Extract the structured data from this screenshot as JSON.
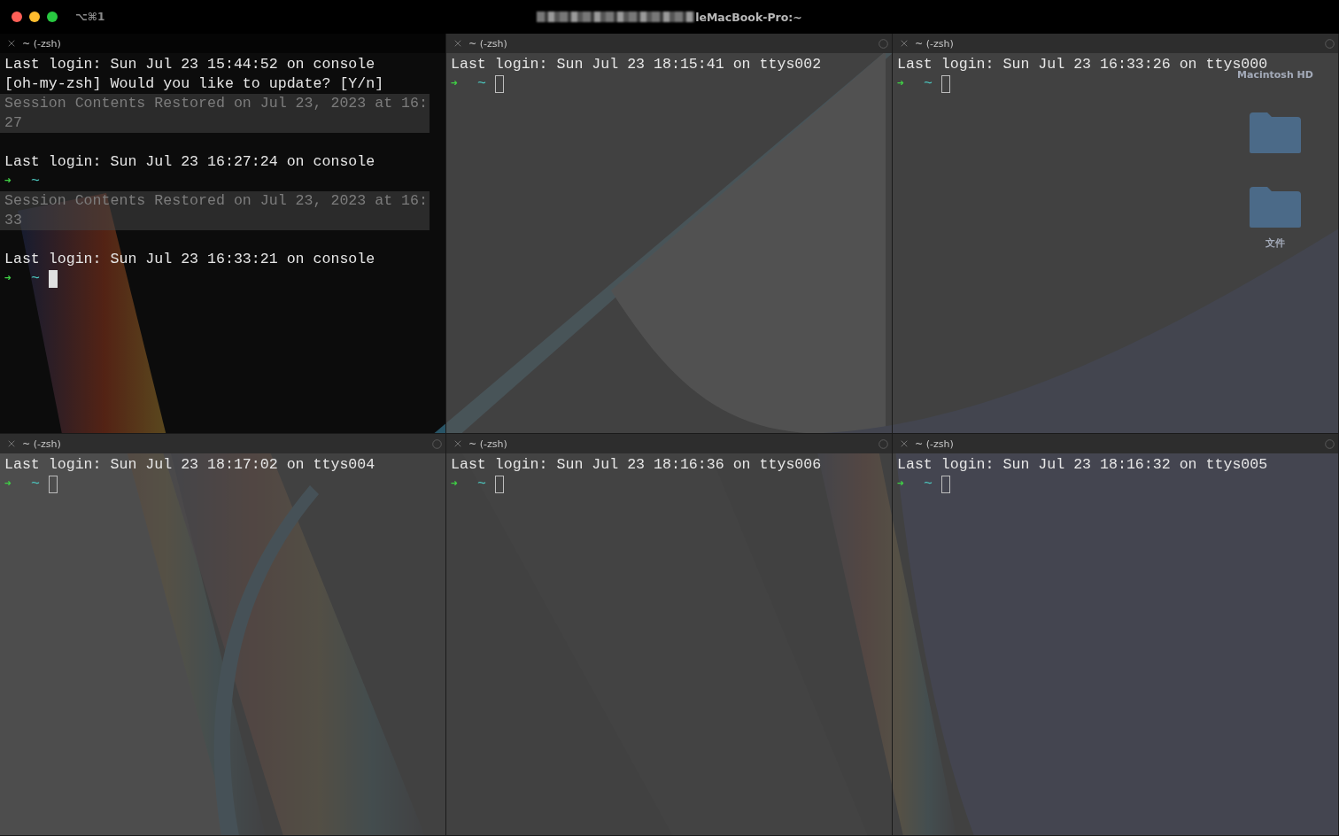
{
  "window": {
    "shortcut": "⌥⌘1",
    "title": "leMacBook-Pro:~"
  },
  "desktop_icons": [
    {
      "kind": "label",
      "label": "Macintosh HD"
    },
    {
      "kind": "folder"
    },
    {
      "kind": "folder",
      "label": "文件"
    }
  ],
  "panes": [
    {
      "title": "~ (-zsh)",
      "active": true,
      "lines": [
        {
          "kind": "output",
          "text": "Last login: Sun Jul 23 15:44:52 on console"
        },
        {
          "kind": "output",
          "text": "[oh-my-zsh] Would you like to update? [Y/n]"
        },
        {
          "kind": "session",
          "lines": [
            "Session Contents Restored on Jul 23, 2023 at 16:",
            "27"
          ]
        },
        {
          "kind": "blank"
        },
        {
          "kind": "output",
          "text": "Last login: Sun Jul 23 16:27:24 on console"
        },
        {
          "kind": "prompt",
          "arrow": "➜",
          "dir": "~",
          "cursor": false
        },
        {
          "kind": "session",
          "lines": [
            "Session Contents Restored on Jul 23, 2023 at 16:",
            "33"
          ]
        },
        {
          "kind": "blank"
        },
        {
          "kind": "output",
          "text": "Last login: Sun Jul 23 16:33:21 on console"
        },
        {
          "kind": "prompt",
          "arrow": "➜",
          "dir": "~",
          "cursor": true
        }
      ]
    },
    {
      "title": "~ (-zsh)",
      "active": false,
      "lines": [
        {
          "kind": "output",
          "text": "Last login: Sun Jul 23 18:15:41 on ttys002"
        },
        {
          "kind": "prompt",
          "arrow": "➜",
          "dir": "~",
          "cursor": true
        }
      ]
    },
    {
      "title": "~ (-zsh)",
      "active": false,
      "lines": [
        {
          "kind": "output",
          "text": "Last login: Sun Jul 23 16:33:26 on ttys000"
        },
        {
          "kind": "prompt",
          "arrow": "➜",
          "dir": "~",
          "cursor": true
        }
      ]
    },
    {
      "title": "~ (-zsh)",
      "active": false,
      "lines": [
        {
          "kind": "output",
          "text": "Last login: Sun Jul 23 18:17:02 on ttys004"
        },
        {
          "kind": "prompt",
          "arrow": "➜",
          "dir": "~",
          "cursor": true
        }
      ]
    },
    {
      "title": "~ (-zsh)",
      "active": false,
      "lines": [
        {
          "kind": "output",
          "text": "Last login: Sun Jul 23 18:16:36 on ttys006"
        },
        {
          "kind": "prompt",
          "arrow": "➜",
          "dir": "~",
          "cursor": true
        }
      ]
    },
    {
      "title": "~ (-zsh)",
      "active": false,
      "lines": [
        {
          "kind": "output",
          "text": "Last login: Sun Jul 23 18:16:32 on ttys005"
        },
        {
          "kind": "prompt",
          "arrow": "➜",
          "dir": "~",
          "cursor": true
        }
      ]
    }
  ]
}
